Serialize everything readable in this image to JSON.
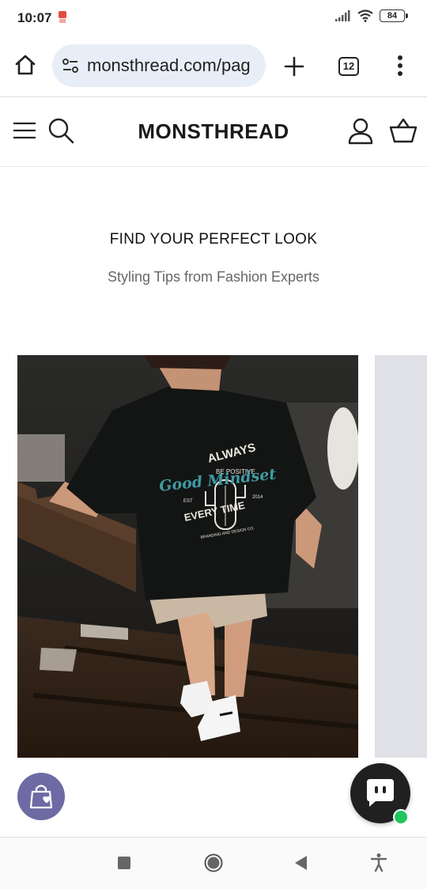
{
  "status_bar": {
    "time": "10:07",
    "app_icon": "paytm-notification-icon",
    "battery_level": "84",
    "icons": [
      "signal-icon",
      "wifi-icon",
      "battery-icon"
    ]
  },
  "browser": {
    "url": "monsthread.com/pag",
    "tab_count": "12",
    "icons": [
      "home-icon",
      "site-settings-icon",
      "new-tab-icon",
      "tab-switcher-icon",
      "overflow-menu-icon"
    ]
  },
  "site_header": {
    "brand": "MONSTHREAD",
    "icons": [
      "menu-icon",
      "search-icon",
      "account-icon",
      "cart-icon"
    ]
  },
  "hero": {
    "title": "FIND YOUR PERFECT LOOK",
    "subtitle": "Styling Tips from Fashion Experts"
  },
  "carousel": {
    "items": [
      {
        "image": "photo-man-black-tshirt-cactus-print",
        "print_text": {
          "top": "ALWAYS",
          "middle_small": "BE POSITIVE",
          "script": "Good Mindset",
          "bottom": "EVERY TIME",
          "left": "EST",
          "right": "2014",
          "brand_line": "BRANDING AND DESIGN CO."
        }
      },
      {
        "image": "next-slide-placeholder"
      }
    ]
  },
  "floating": {
    "wishlist_icon": "shopping-bag-heart-icon",
    "chat_icon": "chat-bubble-icon",
    "online_status": "online"
  },
  "nav_bar": {
    "icons": [
      "recents-icon",
      "home-circle-icon",
      "back-icon",
      "accessibility-icon"
    ]
  },
  "colors": {
    "wishlist_fab": "#6e6aa3",
    "chat_fab": "#202020",
    "online_dot": "#22c55e",
    "url_pill": "#e8eef8",
    "next_slide": "#dfe1e6"
  }
}
